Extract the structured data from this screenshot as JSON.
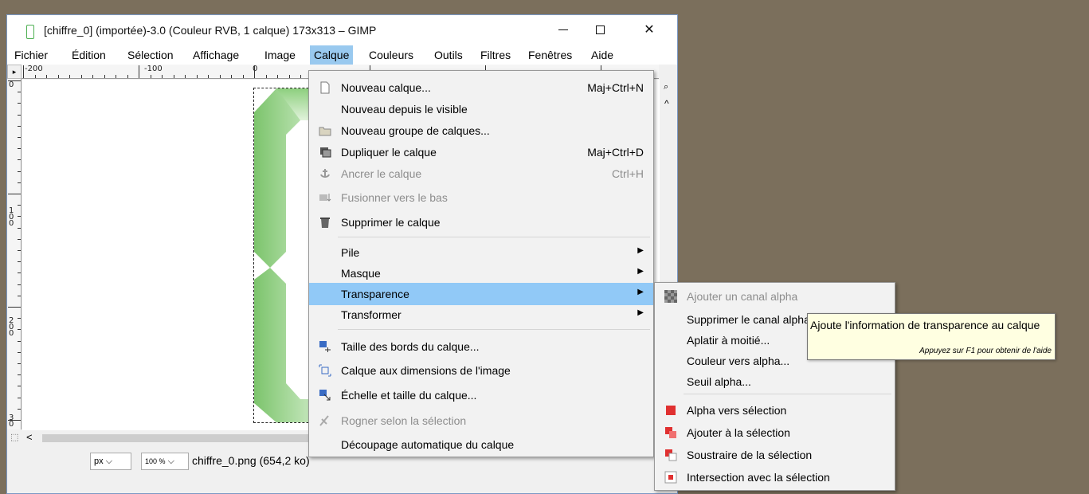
{
  "window": {
    "title": "[chiffre_0] (importée)-3.0 (Couleur RVB, 1 calque) 173x313 – GIMP",
    "minimize": "",
    "maximize": "",
    "close": "✕"
  },
  "menubar": [
    "Fichier",
    "Édition",
    "Sélection",
    "Affichage",
    "Image",
    "Calque",
    "Couleurs",
    "Outils",
    "Filtres",
    "Fenêtres",
    "Aide"
  ],
  "rulers": {
    "h_labels": [
      "-200",
      "-100",
      "0"
    ],
    "v_labels": [
      "0",
      "1\n0\n0",
      "2\n0\n0",
      "3\n0"
    ]
  },
  "calque_menu": {
    "items": [
      {
        "label": "Nouveau calque...",
        "shortcut": "Maj+Ctrl+N",
        "icon": "new-layer-icon"
      },
      {
        "label": "Nouveau depuis le visible",
        "shortcut": "",
        "icon": ""
      },
      {
        "label": "Nouveau groupe de calques...",
        "shortcut": "",
        "icon": "folder-icon"
      },
      {
        "label": "Dupliquer le calque",
        "shortcut": "Maj+Ctrl+D",
        "icon": "duplicate-icon"
      },
      {
        "label": "Ancrer le calque",
        "shortcut": "Ctrl+H",
        "icon": "anchor-icon",
        "disabled": true
      },
      {
        "label": "Fusionner vers le bas",
        "shortcut": "",
        "icon": "merge-down-icon",
        "disabled": true
      },
      {
        "label": "Supprimer le calque",
        "shortcut": "",
        "icon": "trash-icon"
      },
      {
        "label": "Pile",
        "submenu": true
      },
      {
        "label": "Masque",
        "submenu": true
      },
      {
        "label": "Transparence",
        "submenu": true,
        "highlighted": true
      },
      {
        "label": "Transformer",
        "submenu": true
      },
      {
        "label": "Taille des bords du calque...",
        "icon": "layer-boundary-icon"
      },
      {
        "label": "Calque aux dimensions de l'image",
        "icon": "layer-to-image-icon"
      },
      {
        "label": "Échelle et taille du calque...",
        "icon": "scale-layer-icon"
      },
      {
        "label": "Rogner selon la sélection",
        "icon": "crop-icon",
        "disabled": true
      },
      {
        "label": "Découpage automatique du calque"
      }
    ]
  },
  "transparence_menu": {
    "items": [
      {
        "label": "Ajouter un canal alpha",
        "disabled": true
      },
      {
        "label": "Supprimer le canal alpha"
      },
      {
        "label": "Aplatir à moitié..."
      },
      {
        "label": "Couleur vers alpha..."
      },
      {
        "label": "Seuil alpha..."
      },
      {
        "label": "Alpha vers sélection"
      },
      {
        "label": "Ajouter à la sélection"
      },
      {
        "label": "Soustraire de la sélection"
      },
      {
        "label": "Intersection avec la sélection"
      }
    ]
  },
  "tooltip": {
    "text": "Ajoute l'information de transparence au calque",
    "hint": "Appuyez sur F1 pour obtenir de l'aide"
  },
  "status": {
    "unit": "px",
    "zoom": "100 %",
    "file": "chiffre_0.png (654,2 ko)"
  },
  "colors": {
    "highlight": "#91c9f7",
    "menubar_active": "#99c9ef",
    "tooltip_bg": "#ffffe1",
    "desktop": "#7b6f5c"
  }
}
